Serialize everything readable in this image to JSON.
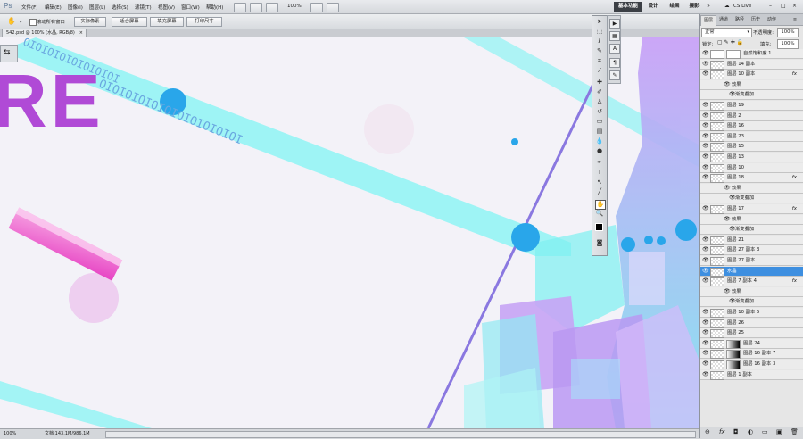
{
  "menubar": {
    "app_logo": "Ps",
    "items": [
      "文件(F)",
      "编辑(E)",
      "图像(I)",
      "图层(L)",
      "选择(S)",
      "滤镜(T)",
      "视图(V)",
      "窗口(W)",
      "帮助(H)"
    ],
    "zoom": "100%",
    "workspaces": [
      "基本功能",
      "设计",
      "绘画",
      "摄影"
    ],
    "more": "»",
    "cs_live": "CS Live"
  },
  "options": {
    "scroll_all_windows": "滚动所有窗口",
    "actual_pixels": "实际像素",
    "fit_screen": "适合屏幕",
    "fill_screen": "填充屏幕",
    "print_size": "打印尺寸"
  },
  "document": {
    "tab_title": "542.psd @ 100% (水晶, RGB/8)",
    "tab_close": "×"
  },
  "canvas_art": {
    "big_letters": "RE",
    "binary_1": "OIOIOIOIOIOIOIOI",
    "binary_2": "OIOIOIOIOIOIOIOIOIOIOI",
    "colors": {
      "magenta": "#b04ad6",
      "cyan": "#6ef3f3",
      "blue": "#29a6ea",
      "violet": "#8a78e0"
    }
  },
  "statusbar": {
    "zoom": "100%",
    "doc": "文档:143.1M/986.1M"
  },
  "layers_panel": {
    "tabs": [
      "图层",
      "通道",
      "路径",
      "历史",
      "动作"
    ],
    "blend_mode": "正常",
    "opacity_label": "不透明度:",
    "opacity": "100%",
    "lock_label": "锁定:",
    "fill_label": "填充:",
    "fill": "100%",
    "rows": [
      {
        "label": "自然饱和度 1",
        "kind": "adjust",
        "fx": ""
      },
      {
        "label": "图层 14 副本",
        "kind": "layer",
        "fx": ""
      },
      {
        "label": "图层 10 副本",
        "kind": "layer",
        "fx": "fx"
      },
      {
        "label": "效果",
        "kind": "effect",
        "fx": ""
      },
      {
        "label": "渐变叠加",
        "kind": "effect2",
        "fx": ""
      },
      {
        "label": "图层 19",
        "kind": "layer",
        "fx": ""
      },
      {
        "label": "图层 2",
        "kind": "layer",
        "fx": ""
      },
      {
        "label": "图层 16",
        "kind": "layer",
        "fx": ""
      },
      {
        "label": "图层 23",
        "kind": "layer",
        "fx": ""
      },
      {
        "label": "图层 15",
        "kind": "layer",
        "fx": ""
      },
      {
        "label": "图层 13",
        "kind": "layer",
        "fx": ""
      },
      {
        "label": "图层 10",
        "kind": "layer",
        "fx": ""
      },
      {
        "label": "图层 18",
        "kind": "layer",
        "fx": "fx"
      },
      {
        "label": "效果",
        "kind": "effect",
        "fx": ""
      },
      {
        "label": "渐变叠加",
        "kind": "effect2",
        "fx": ""
      },
      {
        "label": "图层 17",
        "kind": "layer",
        "fx": "fx"
      },
      {
        "label": "效果",
        "kind": "effect",
        "fx": ""
      },
      {
        "label": "渐变叠加",
        "kind": "effect2",
        "fx": ""
      },
      {
        "label": "图层 21",
        "kind": "layer",
        "fx": ""
      },
      {
        "label": "图层 27 副本 3",
        "kind": "layer",
        "fx": ""
      },
      {
        "label": "图层 27 副本",
        "kind": "layer",
        "fx": ""
      },
      {
        "label": "水晶",
        "kind": "selected",
        "fx": ""
      },
      {
        "label": "图层 7 副本 4",
        "kind": "layer",
        "fx": "fx"
      },
      {
        "label": "效果",
        "kind": "effect",
        "fx": ""
      },
      {
        "label": "渐变叠加",
        "kind": "effect2",
        "fx": ""
      },
      {
        "label": "图层 10 副本 5",
        "kind": "layer",
        "fx": ""
      },
      {
        "label": "图层 26",
        "kind": "layer",
        "fx": ""
      },
      {
        "label": "图层 25",
        "kind": "layer",
        "fx": ""
      },
      {
        "label": "图层 24",
        "kind": "mask",
        "fx": ""
      },
      {
        "label": "图层 16 副本 7",
        "kind": "mask",
        "fx": ""
      },
      {
        "label": "图层 16 副本 3",
        "kind": "mask",
        "fx": ""
      },
      {
        "label": "图层 1 副本",
        "kind": "layer",
        "fx": ""
      }
    ]
  }
}
